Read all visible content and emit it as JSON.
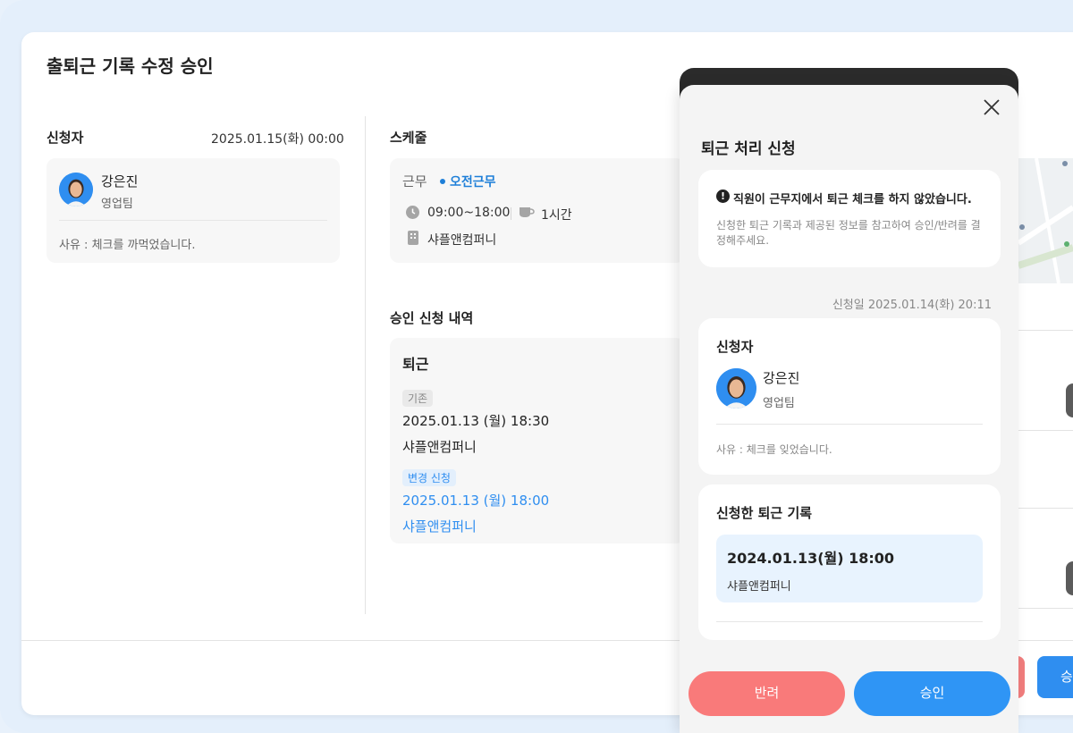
{
  "page": {
    "title": "출퇴근 기록 수정 승인"
  },
  "applicant": {
    "section_title": "신청자",
    "date": "2025.01.15(화) 00:00",
    "name": "강은진",
    "team": "영업팀",
    "reason": "사유 : 체크를 까먹었습니다."
  },
  "schedule": {
    "section_title": "스케줄",
    "work_label": "근무",
    "shift": "오전근무",
    "hours": "09:00~18:00",
    "break": "1시간",
    "company": "샤플앤컴퍼니"
  },
  "approval": {
    "section_title": "승인 신청 내역",
    "type": "퇴근",
    "original_badge": "기존",
    "original_time": "2025.01.13 (월) 18:30",
    "original_place": "샤플앤컴퍼니",
    "change_badge": "변경 신청",
    "change_time": "2025.01.13 (월) 18:00",
    "change_place": "샤플앤컴퍼니"
  },
  "background_buttons": {
    "approve_partial": "승"
  },
  "panel": {
    "title": "퇴근 처리 신청",
    "notice_icon": "!",
    "notice_title": "직원이 근무지에서 퇴근 체크를 하지 않았습니다.",
    "notice_desc": "신청한 퇴근 기록과 제공된 정보를 참고하여 승인/반려를 결정해주세요.",
    "applied_date": "신청일 2025.01.14(화) 20:11",
    "applicant_title": "신청자",
    "name": "강은진",
    "team": "영업팀",
    "reason": "사유 : 체크를 잊었습니다.",
    "record_title": "신청한 퇴근 기록",
    "record_time": "2024.01.13(월) 18:00",
    "record_place": "샤플앤컴퍼니",
    "reject_label": "반려",
    "approve_label": "승인"
  },
  "colors": {
    "accent_blue": "#2f95f5",
    "reject_red": "#f97a7a",
    "shift_blue": "#1e7fd8"
  }
}
